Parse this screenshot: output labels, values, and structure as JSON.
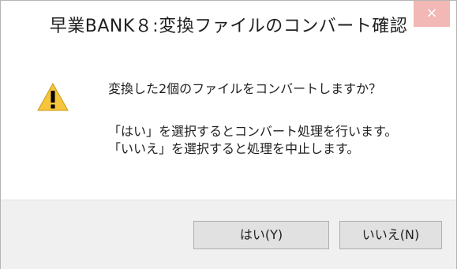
{
  "window": {
    "title": "早業BANK８:変換ファイルのコンバート確認",
    "close_glyph": "×"
  },
  "icon": {
    "name": "warning-icon",
    "color_fill": "#f5c53d",
    "color_mark": "#000000"
  },
  "message": {
    "main": "変換した2個のファイルをコンバートしますか？",
    "detail_line1": "「はい」を選択するとコンバート処理を行います。",
    "detail_line2": "「いいえ」を選択すると処理を中止します。"
  },
  "buttons": {
    "yes_label": "はい(Y)",
    "no_label": "いいえ(N)"
  },
  "colors": {
    "close_button": "#f2b8b5",
    "footer_bg": "#f0f0f0",
    "button_bg": "#e1e1e1"
  }
}
